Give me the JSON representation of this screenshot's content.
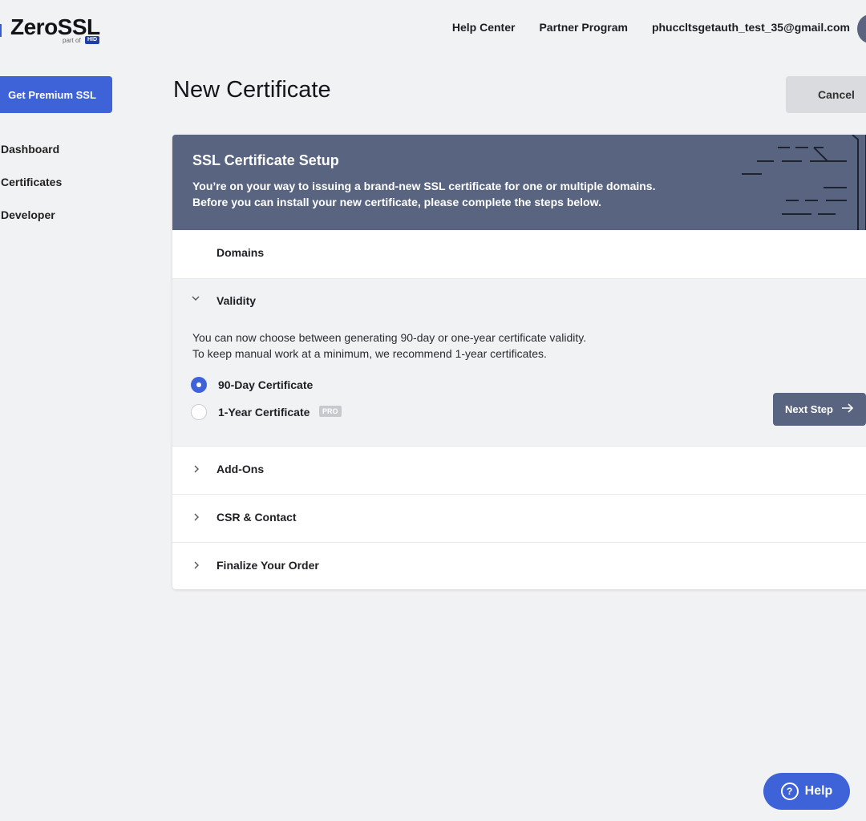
{
  "brand": {
    "name": "ZeroSSL",
    "sub": "part of",
    "owner": "HID"
  },
  "nav": {
    "help_center": "Help Center",
    "partner_program": "Partner Program",
    "user_email": "phuccltsgetauth_test_35@gmail.com"
  },
  "sidebar": {
    "premium_button": "Get Premium SSL",
    "items": [
      {
        "label": "Dashboard"
      },
      {
        "label": "Certificates"
      },
      {
        "label": "Developer"
      }
    ]
  },
  "page": {
    "title": "New Certificate",
    "cancel_label": "Cancel"
  },
  "setup": {
    "title": "SSL Certificate Setup",
    "desc_line1": "You’re on your way to issuing a brand-new SSL certificate for one or multiple domains.",
    "desc_line2": "Before you can install your new certificate, please complete the steps below."
  },
  "steps": {
    "domains": "Domains",
    "validity": "Validity",
    "addons": "Add-Ons",
    "csr": "CSR & Contact",
    "finalize": "Finalize Your Order"
  },
  "validity": {
    "desc_line1": "You can now choose between generating 90-day or one-year certificate validity.",
    "desc_line2": "To keep manual work at a minimum, we recommend 1-year certificates.",
    "option_90": "90-Day Certificate",
    "option_1y": "1-Year Certificate",
    "pro_badge": "PRO",
    "selected": "90-Day Certificate",
    "next_label": "Next Step"
  },
  "help": {
    "label": "Help"
  },
  "colors": {
    "accent": "#3e63d9",
    "header_bg": "#596580",
    "page_bg": "#f1f2f4"
  }
}
